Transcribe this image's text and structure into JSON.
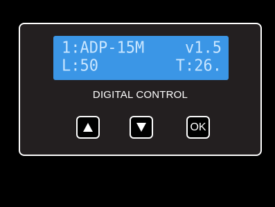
{
  "lcd": {
    "row1_left": "1:ADP-15M",
    "row1_right": "v1.5",
    "row2_left": "L:50",
    "row2_right": "T:26."
  },
  "panel": {
    "label": "DIGITAL CONTROL"
  },
  "buttons": {
    "up_icon": "triangle-up-icon",
    "down_icon": "triangle-down-icon",
    "ok_label": "OK"
  },
  "colors": {
    "background": "#000000",
    "panel": "#231f20",
    "lcd_background": "#3b96e6",
    "lcd_text": "#c9e6ff"
  }
}
